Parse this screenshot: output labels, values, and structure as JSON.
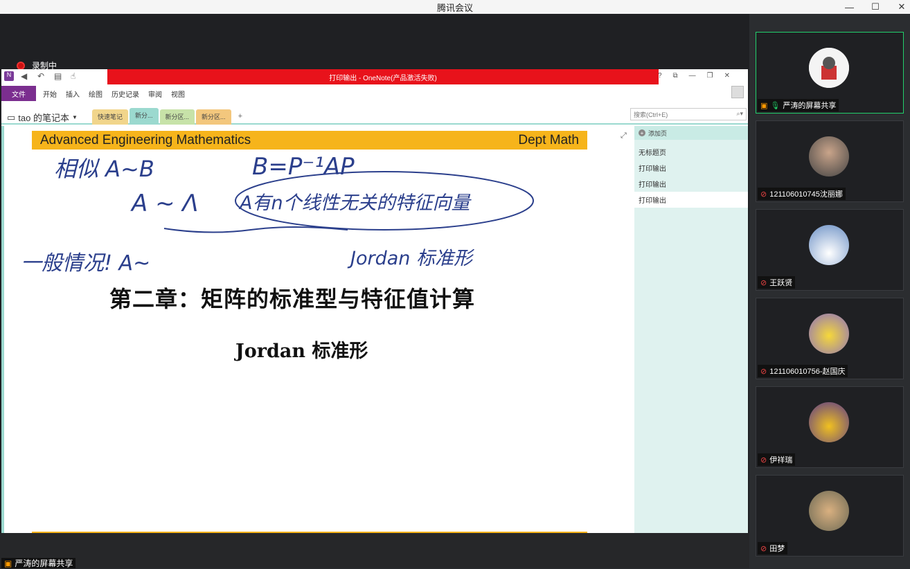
{
  "app_title": "腾讯会议",
  "window_controls": {
    "minimize": "—",
    "maximize": "☐",
    "close": "✕"
  },
  "recording": {
    "label": "录制中"
  },
  "onenote": {
    "title": "打印输出 - OneNote(产品激活失败)",
    "window_controls": [
      "?",
      "⧉",
      "—",
      "❐",
      "✕"
    ],
    "ribbon": {
      "file": "文件",
      "tabs": [
        "开始",
        "插入",
        "绘图",
        "历史记录",
        "审阅",
        "视图"
      ]
    },
    "notebook_name": "tao 的笔记本",
    "sections": [
      "快速笔记",
      "新分...",
      "新分区...",
      "新分区...",
      "+"
    ],
    "search_placeholder": "搜索(Ctrl+E)",
    "page_panel": {
      "add_page": "添加页",
      "pages": [
        "无标题页",
        "打印输出",
        "打印输出",
        "打印输出"
      ]
    },
    "page": {
      "header_left": "Advanced Engineering Mathematics",
      "header_right": "Dept Math",
      "chapter_title": "第二章：矩阵的标准型与特征值计算",
      "subtitle": "Jordan 标准形",
      "handwriting": {
        "line1a": "相似  A~B",
        "line1b": "B=P⁻¹AP",
        "line2a": "A ~ Λ",
        "line2b": "A有n个线性无关的特征向量",
        "line3a": "一般情况!  A~",
        "line3b": "Jordan 标准形"
      }
    }
  },
  "participants": [
    {
      "name": "严涛的屏幕共享",
      "active": true
    },
    {
      "name": "121106010745沈丽娜",
      "active": false
    },
    {
      "name": "王跃贤",
      "active": false
    },
    {
      "name": "121106010756-赵国庆",
      "active": false
    },
    {
      "name": "伊祥瑞",
      "active": false
    },
    {
      "name": "田梦",
      "active": false
    }
  ],
  "bottom_share_label": "严涛的屏幕共享",
  "colors": {
    "onenote_purple": "#7b2e8f",
    "title_red": "#e8121b",
    "header_gold": "#f6b41b",
    "active_green": "#22d06c",
    "ink_blue": "#2b3f8c"
  }
}
